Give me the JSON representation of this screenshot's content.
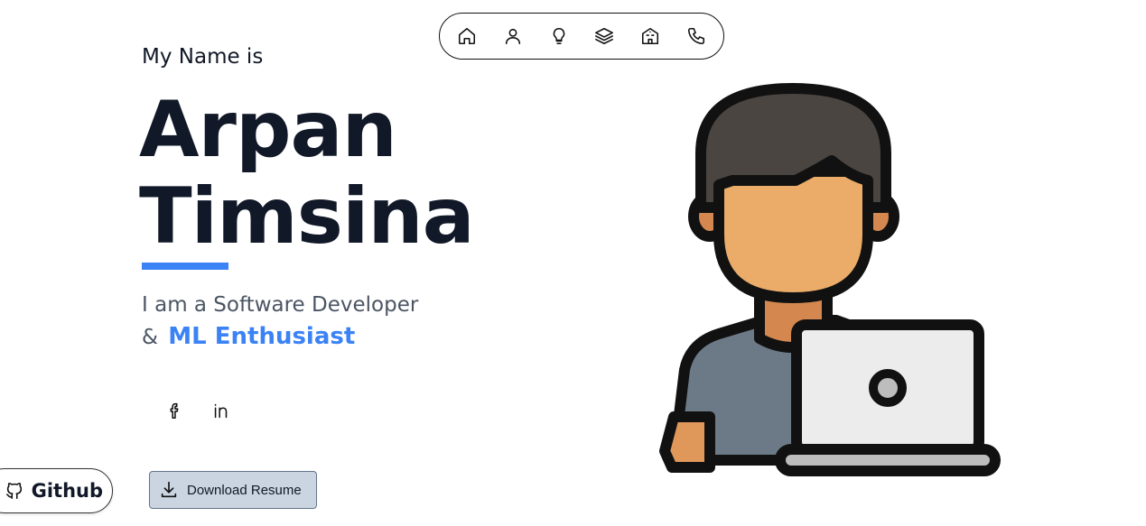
{
  "nav": {
    "items": [
      {
        "icon": "home-icon"
      },
      {
        "icon": "user-icon"
      },
      {
        "icon": "lightbulb-icon"
      },
      {
        "icon": "layers-icon"
      },
      {
        "icon": "building-icon"
      },
      {
        "icon": "phone-icon"
      }
    ]
  },
  "hero": {
    "intro": "My Name is",
    "first_name": "Arpan",
    "last_name": "Timsina",
    "role_line1": "I am a Software Developer",
    "role_line2_prefix": "&",
    "role_line2_accent": "ML Enthusiast"
  },
  "social": {
    "facebook_icon": "facebook-icon",
    "linkedin_icon": "linkedin-icon"
  },
  "github": {
    "label": "Github",
    "icon": "github-icon"
  },
  "download": {
    "label": "Download Resume",
    "icon": "download-icon"
  },
  "colors": {
    "accent": "#3b82f6",
    "text": "#111827",
    "button_bg": "#cbd5e1"
  }
}
